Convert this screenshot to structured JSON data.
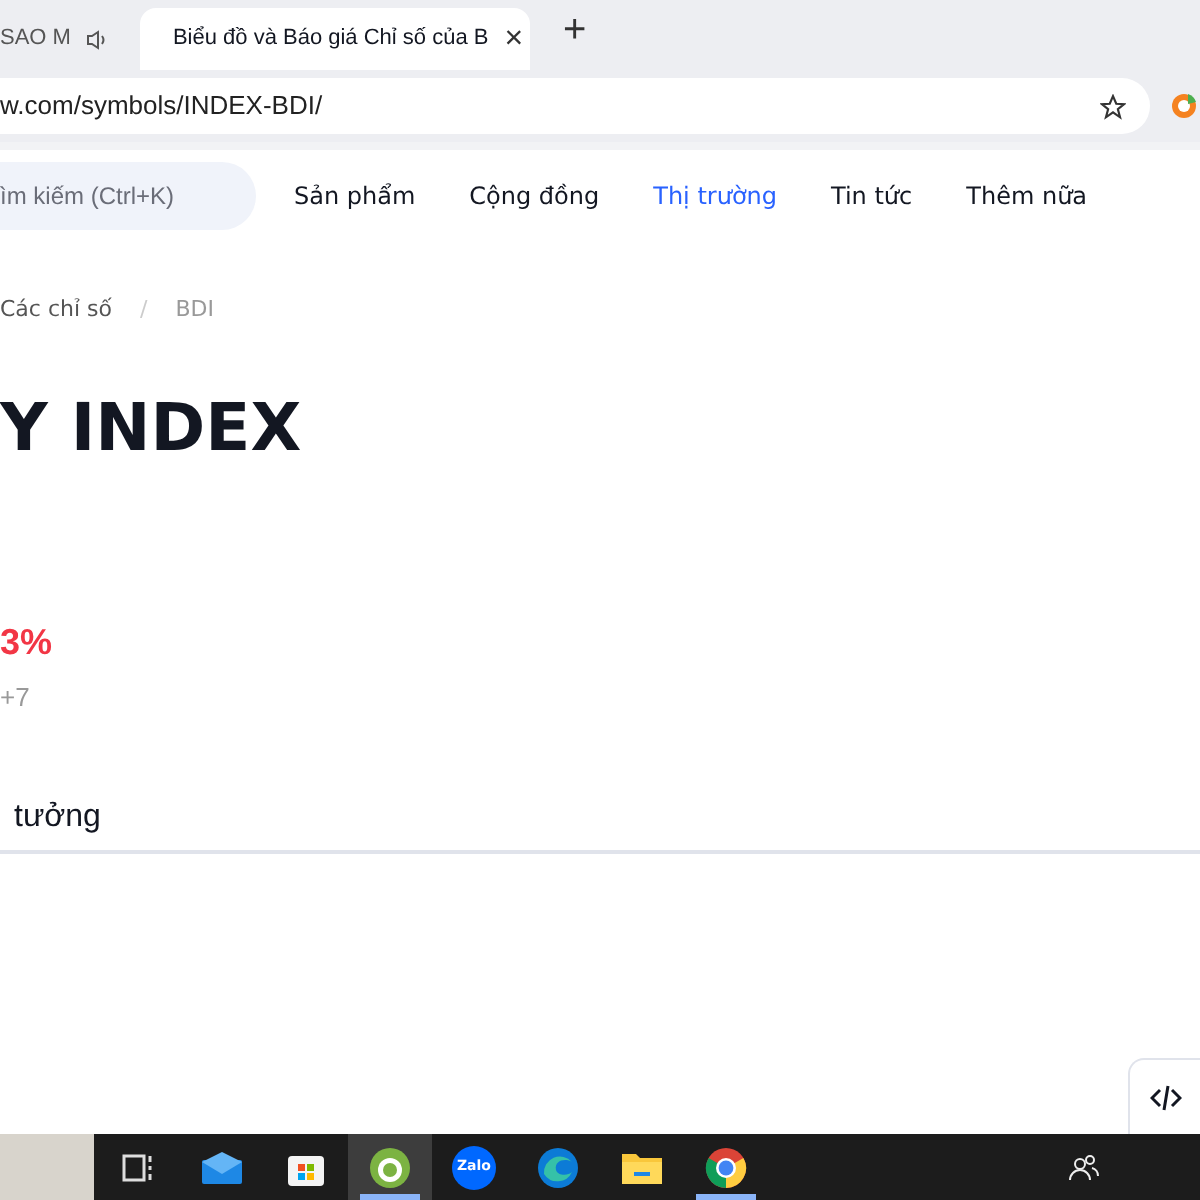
{
  "browser": {
    "tabs": [
      {
        "title": "SAO M",
        "selected": false,
        "audio": true
      },
      {
        "title": "Biểu đồ và Báo giá Chỉ số của B",
        "selected": true,
        "audio": false
      }
    ],
    "new_tab": "+",
    "close": "×",
    "url": "w.com/symbols/INDEX-BDI/"
  },
  "header": {
    "search": {
      "placeholder": "ìm kiếm (Ctrl+K)"
    },
    "nav": [
      {
        "label": "Sản phẩm",
        "selected": false
      },
      {
        "label": "Cộng đồng",
        "selected": false
      },
      {
        "label": "Thị trường",
        "selected": true
      },
      {
        "label": "Tin tức",
        "selected": false
      },
      {
        "label": "Thêm nữa",
        "selected": false
      }
    ]
  },
  "breadcrumb": [
    "Các chỉ số",
    "BDI"
  ],
  "breadcrumb_separator": "/",
  "title": "Y INDEX",
  "change": "3%",
  "time": "+7",
  "section_tab": "tưởng",
  "taskbar": [
    {
      "kind": "taskview",
      "active": false,
      "running": false
    },
    {
      "kind": "mail",
      "active": false,
      "running": false
    },
    {
      "kind": "store",
      "active": false,
      "running": false
    },
    {
      "kind": "coccoc",
      "active": true,
      "running": true
    },
    {
      "kind": "zalo",
      "label": "Zalo",
      "active": false,
      "running": false
    },
    {
      "kind": "edge",
      "active": false,
      "running": false
    },
    {
      "kind": "folder",
      "active": false,
      "running": false
    },
    {
      "kind": "chrome",
      "active": false,
      "running": true
    }
  ]
}
